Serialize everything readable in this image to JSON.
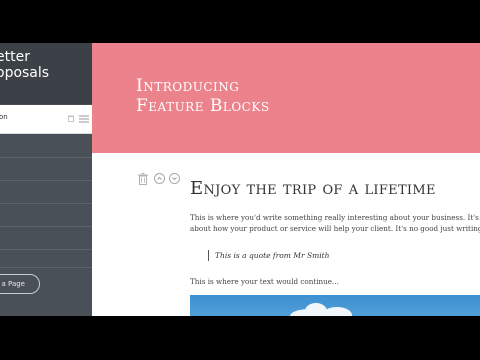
{
  "sidebar": {
    "brand_line1": "etter",
    "brand_line2": "oposals",
    "active_item": "ion",
    "add_page": "a Page"
  },
  "header": {
    "title_line1": "Introducing",
    "title_line2": "Feature Blocks"
  },
  "block": {
    "heading": "Enjoy the trip of a lifetime",
    "para1_line1": "This is where you'd write something really interesting about your business. It's always imp",
    "para1_line2": "about how your product or service will help your client. It's no good just writing about yo",
    "quote": "This is a quote from Mr Smith",
    "para2": "This is where your text would continue..."
  },
  "colors": {
    "header_bg": "#ec828b",
    "sidebar_bg": "#4a5058",
    "brand_bg": "#3c4147"
  },
  "icons": [
    "trash-icon",
    "menu-icon",
    "chevron-up-icon",
    "chevron-down-icon"
  ]
}
